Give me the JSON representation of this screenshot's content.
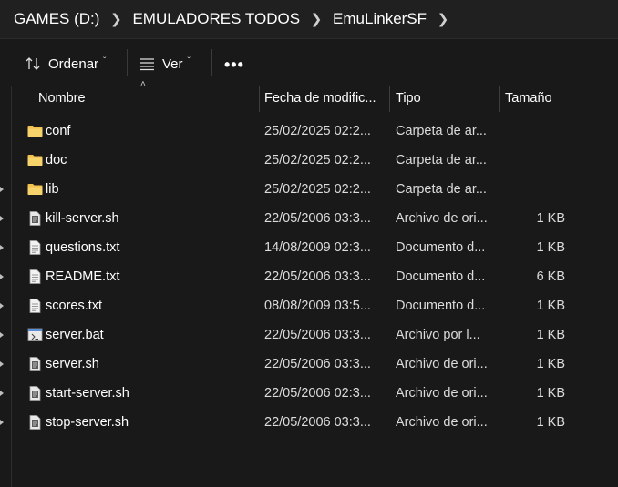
{
  "breadcrumb": [
    "GAMES (D:)",
    "EMULADORES TODOS",
    "EmuLinkerSF"
  ],
  "toolbar": {
    "sort_label": "Ordenar",
    "view_label": "Ver",
    "more_label": "•••"
  },
  "columns": {
    "name": "Nombre",
    "date": "Fecha de modific...",
    "type": "Tipo",
    "size": "Tamaño"
  },
  "files": [
    {
      "name": "conf",
      "date": "25/02/2025 02:2...",
      "type": "Carpeta de ar...",
      "size": "",
      "icon": "folder-icon"
    },
    {
      "name": "doc",
      "date": "25/02/2025 02:2...",
      "type": "Carpeta de ar...",
      "size": "",
      "icon": "folder-icon"
    },
    {
      "name": "lib",
      "date": "25/02/2025 02:2...",
      "type": "Carpeta de ar...",
      "size": "",
      "icon": "folder-icon"
    },
    {
      "name": "kill-server.sh",
      "date": "22/05/2006 03:3...",
      "type": "Archivo de ori...",
      "size": "1 KB",
      "icon": "script-file-icon"
    },
    {
      "name": "questions.txt",
      "date": "14/08/2009 02:3...",
      "type": "Documento d...",
      "size": "1 KB",
      "icon": "text-file-icon"
    },
    {
      "name": "README.txt",
      "date": "22/05/2006 03:3...",
      "type": "Documento d...",
      "size": "6 KB",
      "icon": "text-file-icon"
    },
    {
      "name": "scores.txt",
      "date": "08/08/2009 03:5...",
      "type": "Documento d...",
      "size": "1 KB",
      "icon": "text-file-icon"
    },
    {
      "name": "server.bat",
      "date": "22/05/2006 03:3...",
      "type": "Archivo por l...",
      "size": "1 KB",
      "icon": "batch-file-icon"
    },
    {
      "name": "server.sh",
      "date": "22/05/2006 03:3...",
      "type": "Archivo de ori...",
      "size": "1 KB",
      "icon": "script-file-icon"
    },
    {
      "name": "start-server.sh",
      "date": "22/05/2006 02:3...",
      "type": "Archivo de ori...",
      "size": "1 KB",
      "icon": "script-file-icon"
    },
    {
      "name": "stop-server.sh",
      "date": "22/05/2006 03:3...",
      "type": "Archivo de ori...",
      "size": "1 KB",
      "icon": "script-file-icon"
    }
  ],
  "colors": {
    "background": "#191919",
    "breadcrumb_bar": "#202020",
    "folder": "#f3c24e"
  }
}
